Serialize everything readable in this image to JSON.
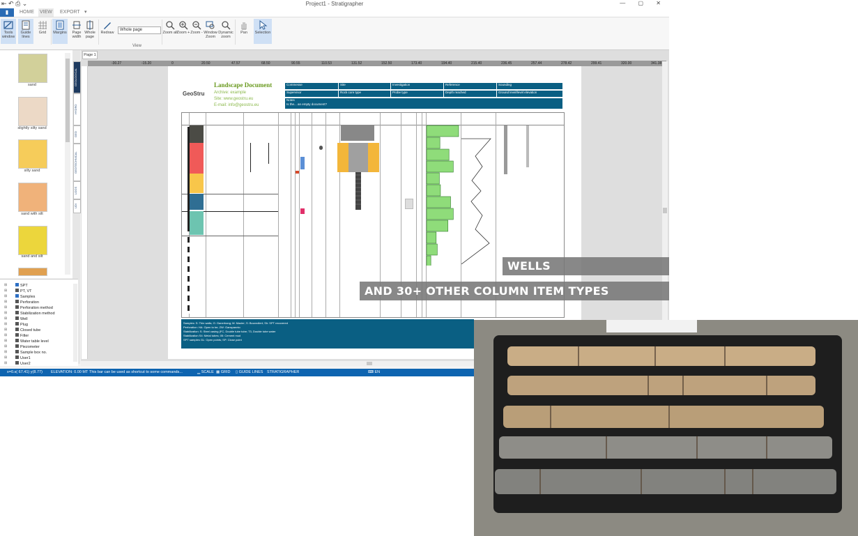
{
  "window": {
    "title": "Project1 - Stratigrapher",
    "quick_access": "⇤ ↶ ⎙ ⌄",
    "controls": "— ▢ ✕"
  },
  "ribbon": {
    "file_label": "▮",
    "tabs": [
      "HOME",
      "VIEW",
      "EXPORT"
    ],
    "overflow": "▾",
    "buttons": [
      {
        "label": "Tools window",
        "icon": "tools-window-icon"
      },
      {
        "label": "Guide lines",
        "icon": "guide-lines-icon"
      },
      {
        "label": "Grid",
        "icon": "grid-icon"
      },
      {
        "label": "Margins",
        "icon": "margins-icon"
      },
      {
        "label": "Page width",
        "icon": "page-width-icon"
      },
      {
        "label": "Whole page",
        "icon": "whole-page-icon"
      },
      {
        "label": "Redraw",
        "icon": "redraw-icon"
      },
      {
        "label": "Zoom all",
        "icon": "zoom-all-icon"
      },
      {
        "label": "Zoom +",
        "icon": "zoom-in-icon"
      },
      {
        "label": "Zoom -",
        "icon": "zoom-out-icon"
      },
      {
        "label": "Window Zoom",
        "icon": "window-zoom-icon"
      },
      {
        "label": "Dynamic zoom",
        "icon": "dynamic-zoom-icon"
      },
      {
        "label": "Pan",
        "icon": "pan-icon"
      },
      {
        "label": "Selection",
        "icon": "selection-icon"
      }
    ],
    "zoom_select": "Whole page",
    "group_view": "View"
  },
  "materials": [
    {
      "label": "sand",
      "color": "#d2d09a"
    },
    {
      "label": "slightly silty sand",
      "color": "#ecd9c6"
    },
    {
      "label": "silty sand",
      "color": "#f6cc5a"
    },
    {
      "label": "sand with silt",
      "color": "#f0b27a"
    },
    {
      "label": "sand and silt",
      "color": "#ecd63c"
    }
  ],
  "vertical_tabs": [
    "GEOLOGICAL",
    "HYDRO",
    "GEO",
    "GEOTECHNICAL",
    "LOGS",
    "UDI"
  ],
  "tree": [
    {
      "label": "SPT",
      "color": "#2d6fc4"
    },
    {
      "label": "PT, VT",
      "color": "#555555"
    },
    {
      "label": "Samples",
      "color": "#2d6fc4"
    },
    {
      "label": "Perforation",
      "color": "#555555"
    },
    {
      "label": "Perforation method",
      "color": "#555555"
    },
    {
      "label": "Stabilization method",
      "color": "#555555"
    },
    {
      "label": "Well",
      "color": "#555555"
    },
    {
      "label": "Plug",
      "color": "#555555"
    },
    {
      "label": "Closed tube",
      "color": "#555555"
    },
    {
      "label": "Filter",
      "color": "#555555"
    },
    {
      "label": "Water table level",
      "color": "#555555"
    },
    {
      "label": "Piezometer",
      "color": "#555555"
    },
    {
      "label": "Sample box no.",
      "color": "#555555"
    },
    {
      "label": "User1",
      "color": "#555555"
    },
    {
      "label": "User2",
      "color": "#555555"
    }
  ],
  "canvas": {
    "page_tab": "Page 1",
    "ruler_ticks": [
      "-30.27",
      "-15.20",
      "0",
      "20.50",
      "47.57",
      "68.50",
      "90.55",
      "110.53",
      "131.52",
      "152.50",
      "173.40",
      "194.40",
      "215.40",
      "236.45",
      "257.44",
      "278.42",
      "299.41",
      "320.00",
      "341.38"
    ],
    "document": {
      "logo": "GeoStru",
      "title": "Landscape Document",
      "lines": [
        "Archive: example",
        "Site: www.geostru.eu",
        "E-mail: info@geostru.eu"
      ],
      "header_cells": [
        [
          "Commesse",
          "Site",
          "Investigation",
          "Reference",
          "Sounding"
        ],
        [
          "Supervisor",
          "Rock core type",
          "Probe type",
          "Depth reached",
          "Ground level/level elevation"
        ]
      ],
      "notes_label": "Notes",
      "notes_text": "Is the... an empty document?",
      "footer_lines": [
        "Samples: S: Thin walls; G: Ganerhang; M: Mazier; S: Bouvrollert; Sh: SPT recovered",
        "Perforation: HA: Open to be; ZW: Ganspannto",
        "Stabilization: S: Steel casing (FC, Double tube tube; T3, Double tube water",
        "Stabilization S4: Metal tubes; 05: Cement mud",
        "SPT samples GL: Open points; SP: Close point"
      ]
    }
  },
  "status": {
    "coords": "x=0.s( 67.41) y(8.77)",
    "elevation": "ELEVATION: 0.00 MT",
    "hint": "This bar can be used as shortcut to some commands...",
    "scale": "SCALE",
    "grid": "GRID",
    "guide_lines": "GUIDE LINES",
    "app": "STRATIGRAPHER",
    "lang": "EN"
  },
  "captions": {
    "wells": "WELLS",
    "others": "AND 30+ OTHER COLUMN ITEM TYPES"
  },
  "colors": {
    "teal": "#0a5f83",
    "status_blue": "#0e64b0",
    "accent_green": "#6a9a1f",
    "bar_green": "#8fdc7a",
    "strata": [
      "#4b4b45",
      "#f05a58",
      "#f8c64a",
      "#2f6e93",
      "#6dc4b0"
    ]
  },
  "chart_histogram": [
    60,
    25,
    42,
    50,
    24,
    26,
    45,
    50,
    40,
    18,
    20,
    8
  ]
}
